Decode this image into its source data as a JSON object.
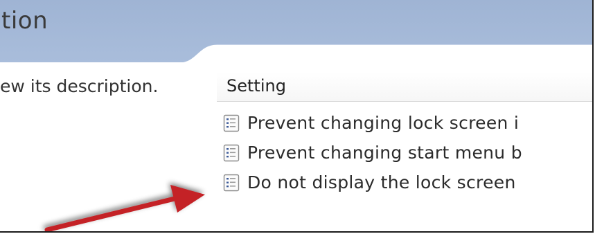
{
  "header": {
    "title_fragment": "tion"
  },
  "left_pane": {
    "description_fragment": "ew its description."
  },
  "list": {
    "column_header": "Setting",
    "items": [
      {
        "label": "Prevent changing lock screen i",
        "icon": "policy-setting-icon"
      },
      {
        "label": "Prevent changing start menu b",
        "icon": "policy-setting-icon"
      },
      {
        "label": "Do not display the lock screen",
        "icon": "policy-setting-icon"
      }
    ]
  },
  "annotation": {
    "arrow_color": "#c42026",
    "points_to_item": 3
  }
}
